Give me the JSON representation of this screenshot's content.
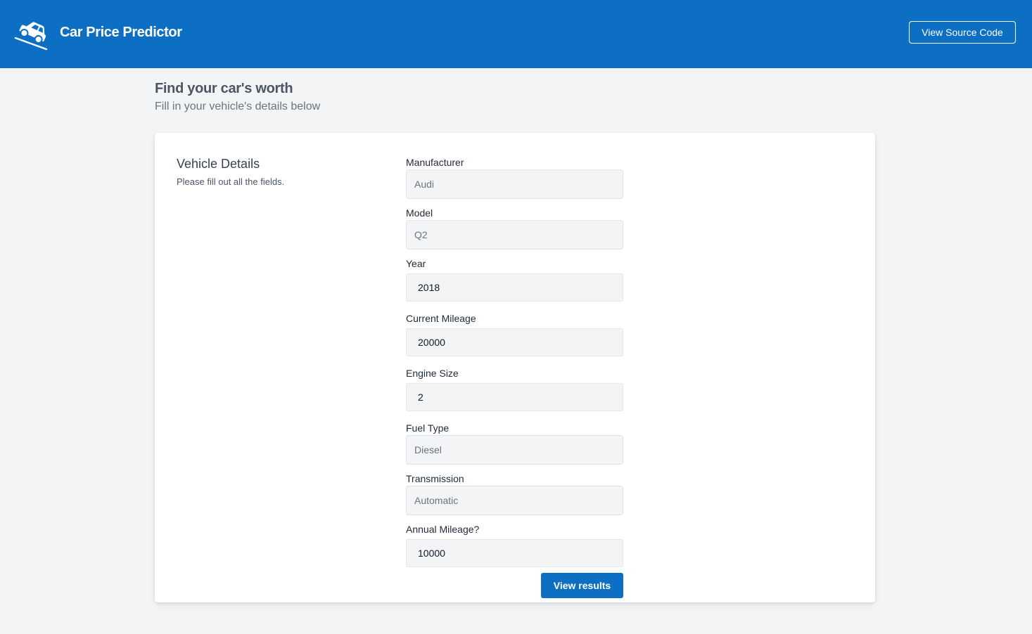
{
  "header": {
    "title": "Car Price Predictor",
    "logo_icon": "car-icon",
    "source_button_label": "View Source Code",
    "background": "#0c6fc3"
  },
  "intro": {
    "title": "Find your car's worth",
    "subtitle": "Fill in your vehicle's details below"
  },
  "card": {
    "title": "Vehicle Details",
    "subtitle": "Please fill out all the fields."
  },
  "form": {
    "manufacturer": {
      "label": "Manufacturer",
      "value": "Audi"
    },
    "model": {
      "label": "Model",
      "value": "Q2"
    },
    "year": {
      "label": "Year",
      "value": "2018"
    },
    "current_mileage": {
      "label": "Current Mileage",
      "value": "20000"
    },
    "engine_size": {
      "label": "Engine Size",
      "value": "2"
    },
    "fuel_type": {
      "label": "Fuel Type",
      "value": "Diesel"
    },
    "transmission": {
      "label": "Transmission",
      "value": "Automatic"
    },
    "annual_mileage": {
      "label": "Annual Mileage?",
      "value": "10000"
    },
    "submit_label": "View results"
  }
}
